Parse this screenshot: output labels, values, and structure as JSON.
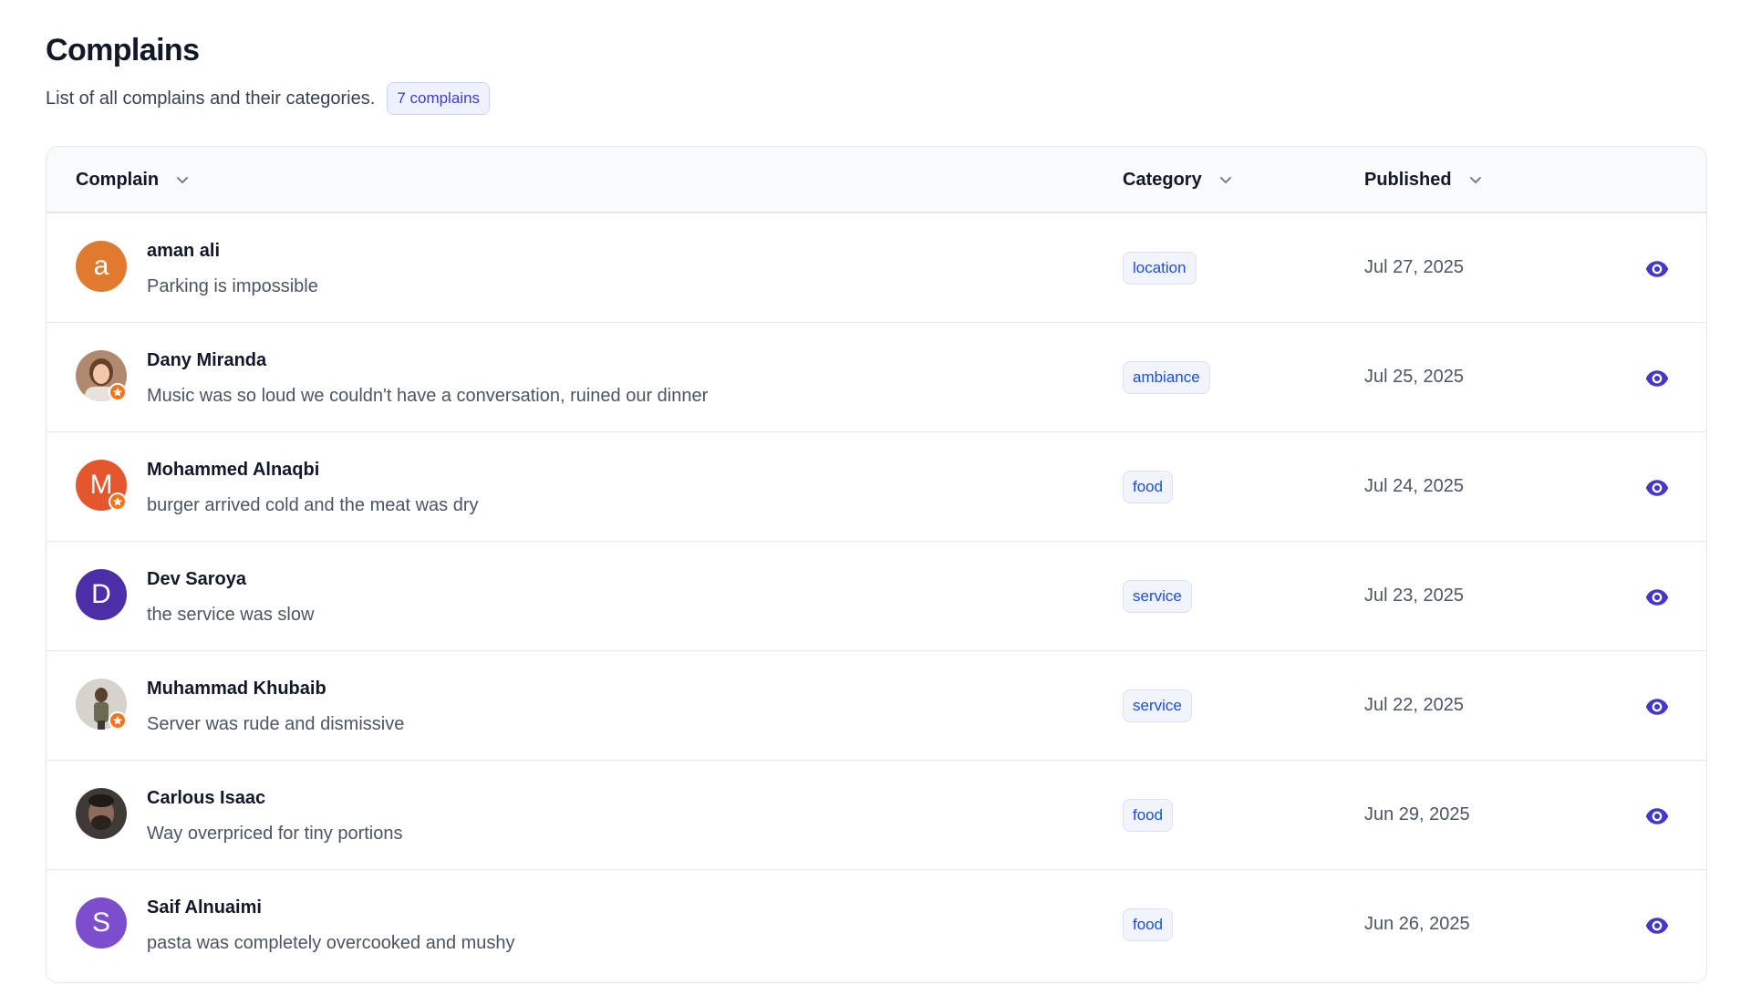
{
  "header": {
    "title": "Complains",
    "subtitle": "List of all complains and their categories.",
    "count_badge": "7 complains"
  },
  "table": {
    "columns": [
      {
        "label": "Complain",
        "icon": "chevron-down-icon"
      },
      {
        "label": "Category",
        "icon": "chevron-down-icon"
      },
      {
        "label": "Published",
        "icon": "chevron-down-icon"
      }
    ],
    "rows": [
      {
        "name": "aman ali",
        "text": "Parking is impossible",
        "category": "location",
        "published": "Jul 27, 2025",
        "avatar": {
          "type": "initial",
          "initial": "a",
          "color": "#e07a2f",
          "badge": false
        }
      },
      {
        "name": "Dany Miranda",
        "text": "Music was so loud we couldn't have a conversation, ruined our dinner",
        "category": "ambiance",
        "published": "Jul 25, 2025",
        "avatar": {
          "type": "photo",
          "badge": true
        }
      },
      {
        "name": "Mohammed Alnaqbi",
        "text": "burger arrived cold and the meat was dry",
        "category": "food",
        "published": "Jul 24, 2025",
        "avatar": {
          "type": "initial",
          "initial": "M",
          "color": "#e4572e",
          "badge": true
        }
      },
      {
        "name": "Dev Saroya",
        "text": "the service was slow",
        "category": "service",
        "published": "Jul 23, 2025",
        "avatar": {
          "type": "initial",
          "initial": "D",
          "color": "#4c2fa8",
          "badge": false
        }
      },
      {
        "name": "Muhammad Khubaib",
        "text": "Server was rude and dismissive",
        "category": "service",
        "published": "Jul 22, 2025",
        "avatar": {
          "type": "photo",
          "badge": true
        }
      },
      {
        "name": "Carlous Isaac",
        "text": "Way overpriced for tiny portions",
        "category": "food",
        "published": "Jun 29, 2025",
        "avatar": {
          "type": "photo",
          "badge": false
        }
      },
      {
        "name": "Saif Alnuaimi",
        "text": "pasta was completely overcooked and mushy",
        "category": "food",
        "published": "Jun 26, 2025",
        "avatar": {
          "type": "initial",
          "initial": "S",
          "color": "#7c4dcc",
          "badge": false
        }
      }
    ],
    "row_action_icon": "eye-icon"
  },
  "colors": {
    "accent": "#4338ca",
    "category_text": "#1d4ed8",
    "badge_orange": "#f97316"
  }
}
